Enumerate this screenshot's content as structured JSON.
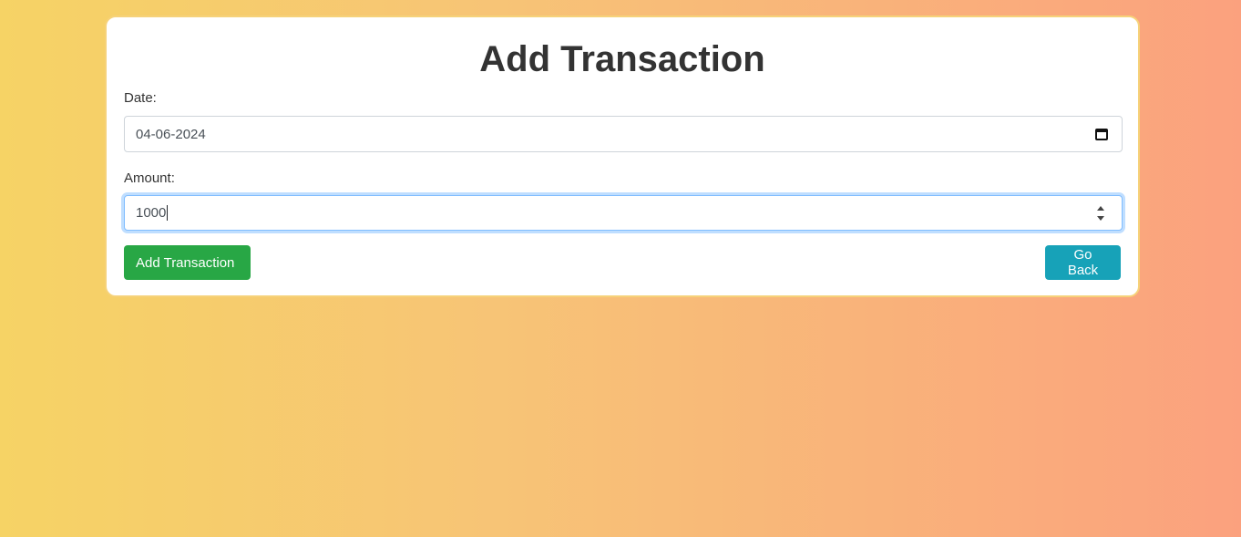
{
  "form": {
    "title": "Add Transaction",
    "date_label": "Date:",
    "date_value": "04-06-2024",
    "amount_label": "Amount:",
    "amount_value": "1000",
    "submit_label": "Add Transaction",
    "back_label": "Go Back"
  },
  "colors": {
    "submit_button": "#28a745",
    "back_button": "#17a2b8",
    "focus_ring": "#80bdff"
  },
  "icons": {
    "date_picker": "calendar-icon",
    "amount_stepper": "spinner-arrows-icon"
  }
}
